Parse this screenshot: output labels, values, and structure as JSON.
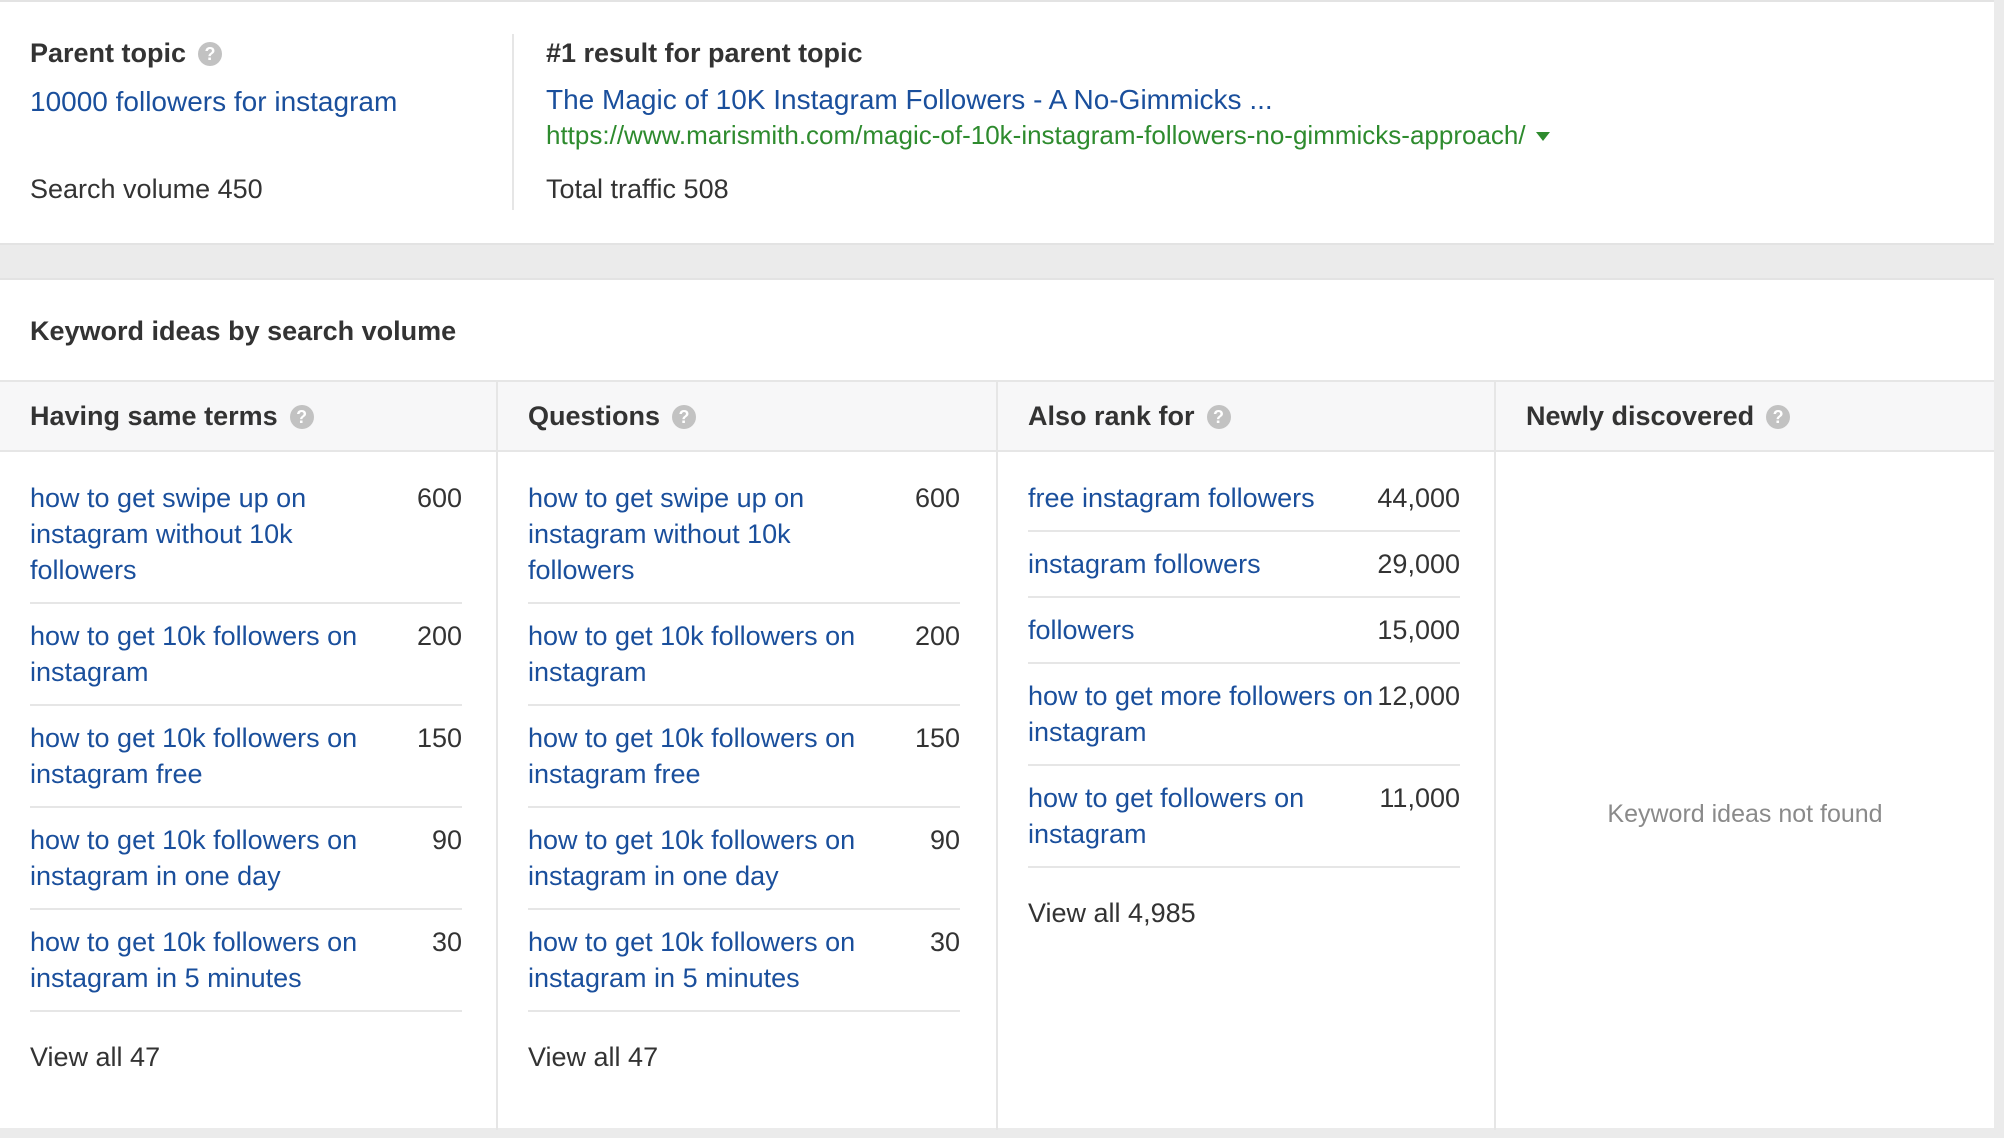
{
  "parent_topic": {
    "heading": "Parent topic",
    "keyword": "10000 followers for instagram",
    "search_volume": "Search volume 450"
  },
  "top_result": {
    "heading": "#1 result for parent topic",
    "title": "The Magic of 10K Instagram Followers - A No-Gimmicks ...",
    "url": "https://www.marismith.com/magic-of-10k-instagram-followers-no-gimmicks-approach/",
    "total_traffic": "Total traffic 508"
  },
  "ideas": {
    "title": "Keyword ideas by search volume",
    "columns": [
      {
        "header": "Having same terms",
        "rows": [
          {
            "keyword": "how to get swipe up on instagram without 10k followers",
            "volume": "600"
          },
          {
            "keyword": "how to get 10k followers on instagram",
            "volume": "200"
          },
          {
            "keyword": "how to get 10k followers on instagram free",
            "volume": "150"
          },
          {
            "keyword": "how to get 10k followers on instagram in one day",
            "volume": "90"
          },
          {
            "keyword": "how to get 10k followers on instagram in 5 minutes",
            "volume": "30"
          }
        ],
        "view_all": "View all 47"
      },
      {
        "header": "Questions",
        "rows": [
          {
            "keyword": "how to get swipe up on instagram without 10k followers",
            "volume": "600"
          },
          {
            "keyword": "how to get 10k followers on instagram",
            "volume": "200"
          },
          {
            "keyword": "how to get 10k followers on instagram free",
            "volume": "150"
          },
          {
            "keyword": "how to get 10k followers on instagram in one day",
            "volume": "90"
          },
          {
            "keyword": "how to get 10k followers on instagram in 5 minutes",
            "volume": "30"
          }
        ],
        "view_all": "View all 47"
      },
      {
        "header": "Also rank for",
        "rows": [
          {
            "keyword": "free instagram followers",
            "volume": "44,000"
          },
          {
            "keyword": "instagram followers",
            "volume": "29,000"
          },
          {
            "keyword": "followers",
            "volume": "15,000"
          },
          {
            "keyword": "how to get more followers on instagram",
            "volume": "12,000"
          },
          {
            "keyword": "how to get followers on instagram",
            "volume": "11,000"
          }
        ],
        "view_all": "View all 4,985"
      },
      {
        "header": "Newly discovered",
        "rows": [],
        "empty_message": "Keyword ideas not found"
      }
    ]
  },
  "icons": {
    "help": "?"
  },
  "colors": {
    "link": "#1a4f9c",
    "url": "#2e8b2e",
    "text": "#333333",
    "muted": "#8a8a8a",
    "help_icon": "#c2c2c2"
  }
}
